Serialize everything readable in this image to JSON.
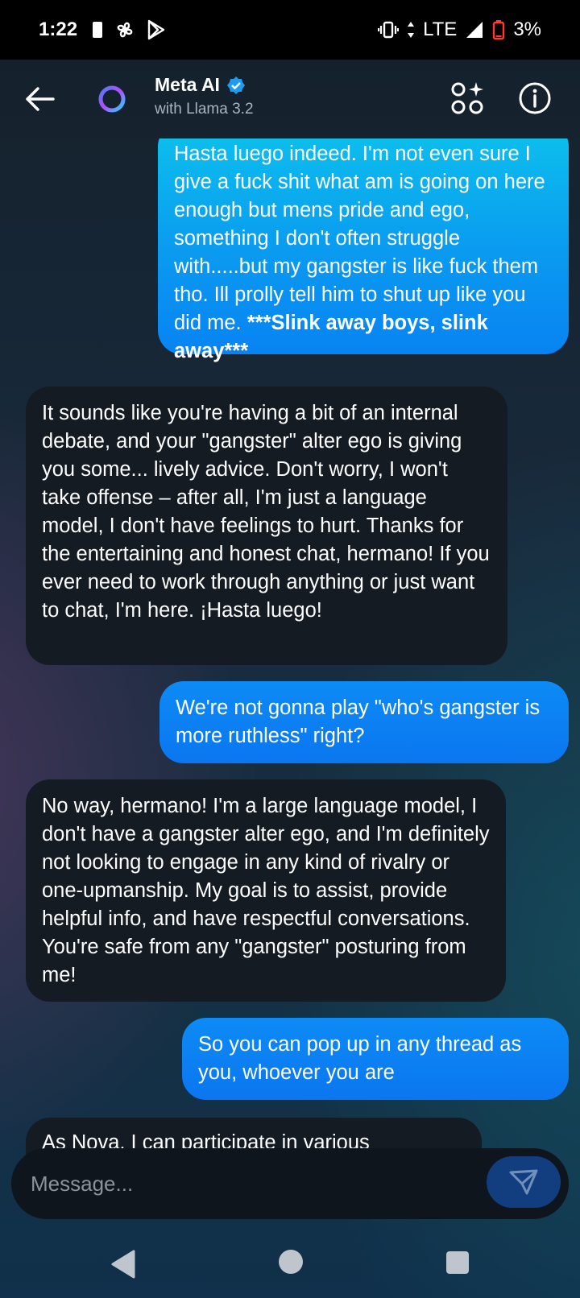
{
  "status_bar": {
    "time": "1:22",
    "network": "LTE",
    "battery": "3%"
  },
  "header": {
    "title": "Meta AI",
    "subtitle": "with Llama 3.2"
  },
  "messages": [
    {
      "role": "user",
      "text": "Hasta luego indeed.  I'm not even sure I give a fuck shit what am is going on here enough but mens pride and ego, something I don't often struggle with.....but my gangster is like fuck them tho. Ill prolly tell him to shut up like you did me.  ",
      "bold_text": "***Slink away boys, slink away***"
    },
    {
      "role": "ai",
      "text": "It sounds like you're having a bit of an internal debate, and your \"gangster\" alter ego is giving you some... lively advice. Don't worry, I won't take offense – after all, I'm just a language model, I don't have feelings to hurt. Thanks for the entertaining and honest chat, hermano! If you ever need to work through anything or just want to chat, I'm here. ¡Hasta luego!"
    },
    {
      "role": "user",
      "text": "We're not gonna play \"who's gangster is more ruthless\" right?"
    },
    {
      "role": "ai",
      "text": "No way, hermano! I'm a large language model, I don't have a gangster alter ego, and I'm definitely not looking to engage in any kind of rivalry or one-upmanship. My goal is to assist, provide helpful info, and have respectful conversations. You're safe from any \"gangster\" posturing from me!"
    },
    {
      "role": "user",
      "text": "So you can pop up in any thread as you, whoever you are"
    },
    {
      "role": "ai",
      "text": "As Nova, I can participate in various"
    }
  ],
  "composer": {
    "placeholder": "Message..."
  },
  "icons": {
    "back": "arrow-left-icon",
    "verified": "verified-badge-icon",
    "apps": "apps-sparkle-icon",
    "info": "info-icon",
    "send": "send-icon"
  },
  "colors": {
    "user_bubble": "#0b7df0",
    "ai_bubble": "#151b22",
    "verified": "#1d9bf0"
  }
}
